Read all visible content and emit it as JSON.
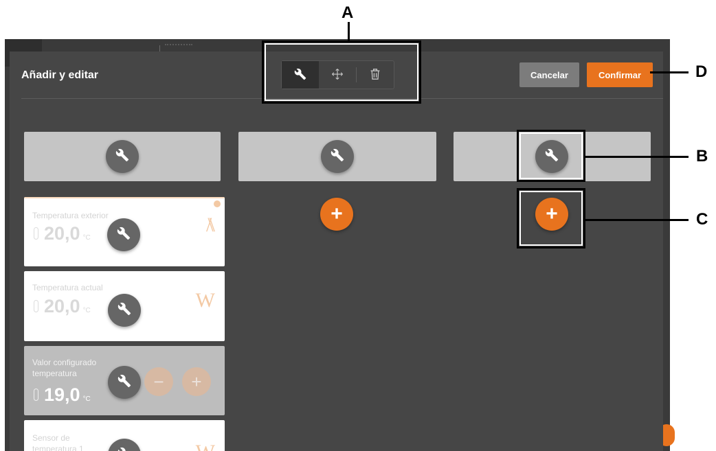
{
  "header": {
    "title": "Añadir y editar",
    "cancel_label": "Cancelar",
    "confirm_label": "Confirmar"
  },
  "mode_toolbar": {
    "modes": [
      {
        "name": "edit",
        "icon": "wrench-icon",
        "active": true
      },
      {
        "name": "move",
        "icon": "move-arrows-icon",
        "active": false
      },
      {
        "name": "delete",
        "icon": "trash-icon",
        "active": false
      }
    ]
  },
  "columns": [
    {
      "slot_icon": "wrench-icon",
      "has_add_button": false
    },
    {
      "slot_icon": "wrench-icon",
      "has_add_button": true
    },
    {
      "slot_icon": "wrench-icon",
      "has_add_button": true
    }
  ],
  "tiles": [
    {
      "label": "Temperatura exterior",
      "value": "20,0",
      "unit": "°C"
    },
    {
      "label": "Temperatura actual",
      "value": "20,0",
      "unit": "°C"
    },
    {
      "label": "Valor configurado temperatura",
      "value": "19,0",
      "unit": "°C",
      "decrement": "−",
      "increment": "+"
    },
    {
      "label": "Sensor de temperatura 1",
      "value": "",
      "unit": ""
    }
  ],
  "add_symbol": "+",
  "annotations": {
    "a": "A",
    "b": "B",
    "c": "C",
    "d": "D"
  },
  "colors": {
    "accent": "#e8731e",
    "panel": "#464646",
    "slot": "#c5c5c5",
    "wrench_button": "#666666",
    "cancel": "#7c7c7c"
  }
}
